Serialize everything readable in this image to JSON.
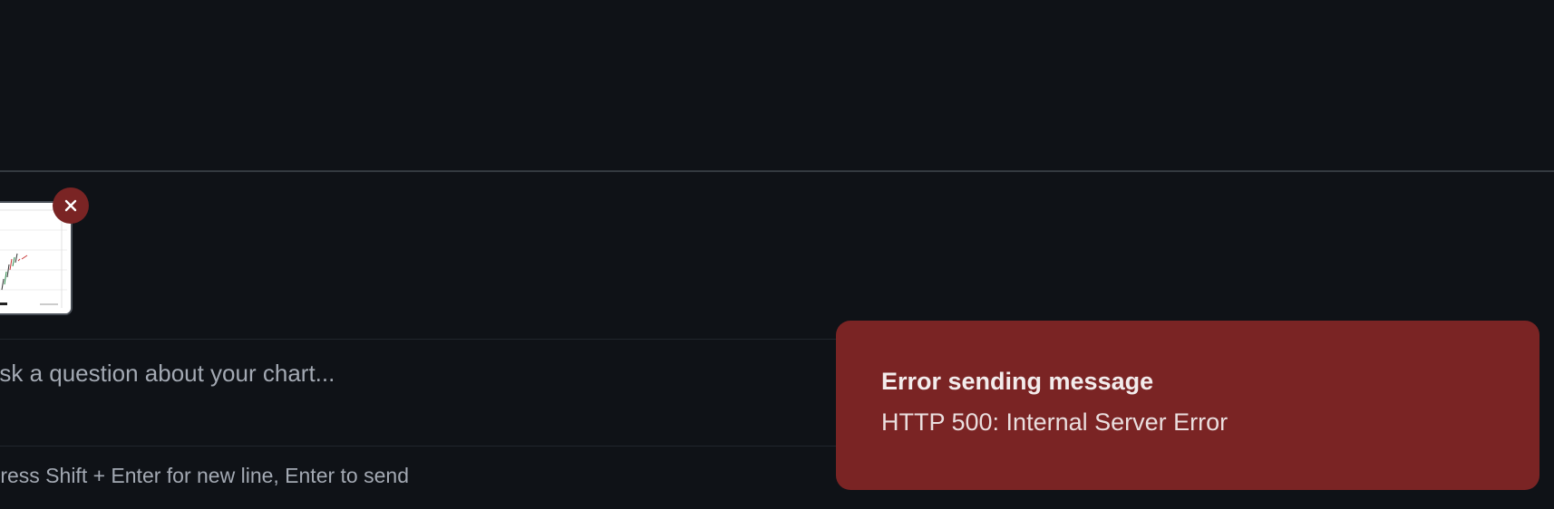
{
  "composer": {
    "placeholder": "Ask a question about your chart...",
    "hint": "Press Shift + Enter for new line, Enter to send"
  },
  "attachment": {
    "remove_icon": "close-icon",
    "thumbnail": "chart-thumbnail"
  },
  "toast": {
    "title": "Error sending message",
    "description": "HTTP 500: Internal Server Error",
    "background_color": "#7a2424"
  },
  "colors": {
    "background": "#0f1217",
    "muted_text": "#a3a9b3"
  }
}
